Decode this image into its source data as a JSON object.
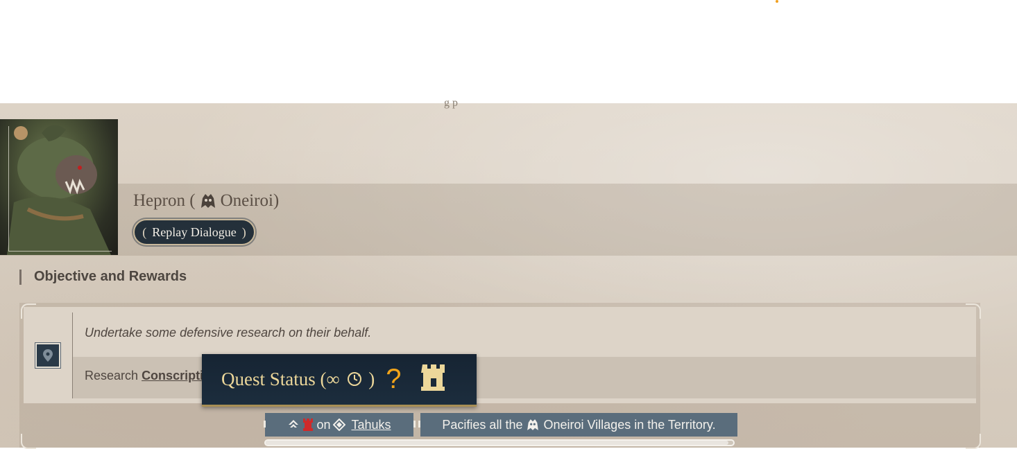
{
  "header": {
    "cut_off_text": "g                                         p",
    "npc_name": "Hepron (",
    "npc_faction": "Oneiroi)",
    "replay_button": {
      "open_paren": "(",
      "label": "Replay Dialogue",
      "close_paren": ")"
    }
  },
  "objectives": {
    "section_title": "Objective and Rewards",
    "description": "Undertake some defensive research on their behalf.",
    "research_prefix": "Research",
    "research_link": "Conscriptio"
  },
  "tooltip": {
    "title": "Quest Status (∞",
    "title_end": ")",
    "question_mark": "?"
  },
  "effects": {
    "on_text": "on",
    "target_link": "Tahuks",
    "reward_prefix": "Pacifies all the",
    "reward_suffix": "Oneiroi Villages in the Territory."
  },
  "progress": {
    "value": 0.99
  },
  "colors": {
    "parchment": "#d9cfc2",
    "tooltip_bg": "#1a2938",
    "tooltip_title": "#ecd79a",
    "accent_orange": "#f2a41a",
    "effect_bar": "#5a6d7c"
  },
  "icons": [
    "faction-oneiroi-icon",
    "map-pin-icon",
    "cycle-clock-icon",
    "question-mark-icon",
    "rook-tower-icon",
    "arrow-up-icon",
    "red-tower-icon",
    "diamond-icon"
  ]
}
